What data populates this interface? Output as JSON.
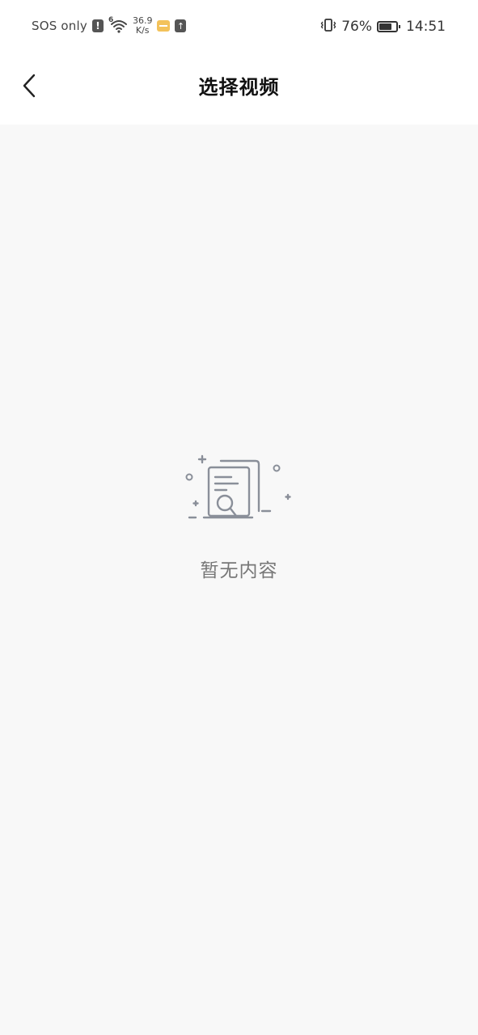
{
  "status_bar": {
    "carrier_text": "SOS only",
    "alert_glyph": "!",
    "wifi_label": "6",
    "speed_value": "36.9",
    "speed_unit": "K/s",
    "upload_glyph": "↑",
    "battery_percent": "76%",
    "battery_level": 0.76,
    "time": "14:51",
    "icons": [
      "alert-icon",
      "wifi-icon",
      "notification-icon",
      "upload-icon",
      "vibrate-icon",
      "battery-icon"
    ]
  },
  "header": {
    "title": "选择视频",
    "back_icon": "chevron-left-icon"
  },
  "empty_state": {
    "icon": "document-search-icon",
    "message": "暂无内容"
  },
  "colors": {
    "background": "#f8f8f8",
    "header_bg": "#ffffff",
    "title": "#111111",
    "empty_text": "#777777",
    "icon_stroke": "#8a8f99"
  }
}
